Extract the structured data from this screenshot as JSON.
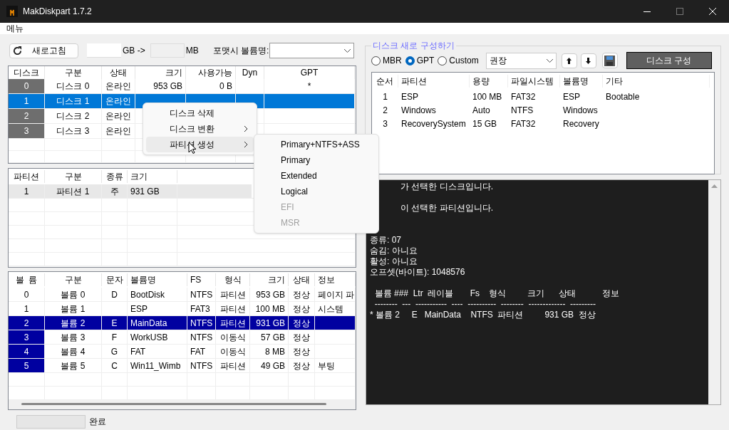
{
  "window": {
    "title": "MakDiskpart 1.7.2"
  },
  "menu_bar": [
    "메뉴"
  ],
  "toolbar": {
    "refresh": "새로고침",
    "gb_unit": "GB ->",
    "mb_unit": "MB",
    "volume_label": "포맷시 볼륨명:"
  },
  "disk_table": {
    "columns": [
      "디스크",
      "구분",
      "상태",
      "크기",
      "사용가능",
      "Dyn",
      "GPT"
    ],
    "rows": [
      {
        "selected": false,
        "cells": [
          "0",
          "디스크 0",
          "온라인",
          "953 GB",
          "0 B",
          "",
          "*"
        ]
      },
      {
        "selected": true,
        "cells": [
          "1",
          "디스크 1",
          "온라인",
          "",
          "",
          "",
          ""
        ]
      },
      {
        "selected": false,
        "cells": [
          "2",
          "디스크 2",
          "온라인",
          "",
          "",
          "",
          ""
        ]
      },
      {
        "selected": false,
        "cells": [
          "3",
          "디스크 3",
          "온라인",
          "",
          "",
          "",
          ""
        ]
      }
    ]
  },
  "partition_table": {
    "columns": [
      "파티션",
      "구분",
      "종류",
      "크기"
    ],
    "rows": [
      {
        "selected": true,
        "cells": [
          "1",
          "파티션 1",
          "주",
          "931 GB"
        ]
      }
    ]
  },
  "volume_table": {
    "columns": [
      "볼  륨",
      "구분",
      "문자",
      "볼륨명",
      "FS",
      "형식",
      "크기",
      "상태",
      "정보"
    ],
    "rows": [
      {
        "selected": false,
        "marked": false,
        "cells": [
          "0",
          "볼륨 0",
          "D",
          "BootDisk",
          "NTFS",
          "파티션",
          "953 GB",
          "정상",
          "페이지 파"
        ]
      },
      {
        "selected": false,
        "marked": false,
        "cells": [
          "1",
          "볼륨 1",
          "",
          "ESP",
          "FAT3",
          "파티션",
          "100 MB",
          "정상",
          "시스템"
        ]
      },
      {
        "selected": true,
        "marked": true,
        "cells": [
          "2",
          "볼륨 2",
          "E",
          "MainData",
          "NTFS",
          "파티션",
          "931 GB",
          "정상",
          ""
        ]
      },
      {
        "selected": false,
        "marked": true,
        "cells": [
          "3",
          "볼륨 3",
          "F",
          "WorkUSB",
          "NTFS",
          "이동식",
          "57 GB",
          "정상",
          ""
        ]
      },
      {
        "selected": false,
        "marked": true,
        "cells": [
          "4",
          "볼륨 4",
          "G",
          "FAT",
          "FAT",
          "이동식",
          "8 MB",
          "정상",
          ""
        ]
      },
      {
        "selected": false,
        "marked": true,
        "cells": [
          "5",
          "볼륨 5",
          "C",
          "Win11_Wimb",
          "NTFS",
          "파티션",
          "49 GB",
          "정상",
          "부팅"
        ]
      }
    ]
  },
  "reconfigure": {
    "title": "디스크 새로 구성하기",
    "schemes": [
      {
        "label": "MBR",
        "selected": false
      },
      {
        "label": "GPT",
        "selected": true
      },
      {
        "label": "Custom",
        "selected": false
      }
    ],
    "preset": "권장",
    "apply": "디스크 구성",
    "columns": [
      "순서",
      "파티션",
      "용량",
      "파일시스템",
      "볼륨명",
      "기타"
    ],
    "rows": [
      [
        "1",
        "ESP",
        "100 MB",
        "FAT32",
        "ESP",
        "Bootable"
      ],
      [
        "2",
        "Windows",
        "Auto",
        "NTFS",
        "Windows",
        ""
      ],
      [
        "3",
        "RecoverySystem",
        "15 GB",
        "FAT32",
        "Recovery",
        ""
      ]
    ]
  },
  "console": {
    "covered_blocks": [
      [
        "가 선택한 디스크입니다."
      ],
      [
        "이 선택한 파티션입니다."
      ]
    ],
    "blocks": [
      [
        "종류: 07",
        "숨김: 아니요",
        "활성: 아니요",
        "오프셋(바이트): 1048576"
      ],
      [
        "  볼륨 ###  Ltr  레이블       Fs    형식         크기      상태           정보",
        "  --------  ---  -----------  ----  ----------  --------  -------------  ---------",
        "* 볼륨 2     E   MainData    NTFS  파티션         931 GB  정상"
      ]
    ]
  },
  "context_menu": [
    {
      "label": "디스크 삭제",
      "submenu": false,
      "selected": false
    },
    {
      "label": "디스크 변환",
      "submenu": true,
      "selected": false
    },
    {
      "label": "파티션 생성",
      "submenu": true,
      "selected": true
    }
  ],
  "submenu": [
    {
      "label": "Primary+NTFS+ASS",
      "disabled": false
    },
    {
      "label": "Primary",
      "disabled": false
    },
    {
      "label": "Extended",
      "disabled": false
    },
    {
      "label": "Logical",
      "disabled": false
    },
    {
      "label": "EFI",
      "disabled": true
    },
    {
      "label": "MSR",
      "disabled": true
    }
  ],
  "status_bar": {
    "text": "완료"
  }
}
